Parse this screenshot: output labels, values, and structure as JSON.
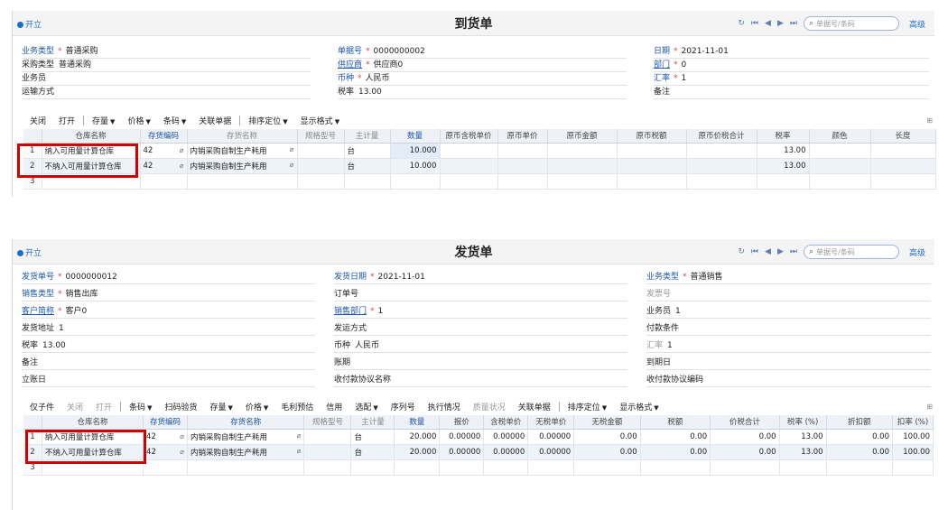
{
  "common": {
    "kaili": "开立",
    "search_placeholder": "单据号/条码",
    "advanced": "高级",
    "nav_icons": [
      "refresh-icon",
      "first-icon",
      "prev-icon",
      "next-icon",
      "last-icon"
    ]
  },
  "arrival": {
    "title": "到货单",
    "fields": {
      "biz_type": {
        "label": "业务类型",
        "value": "普通采购"
      },
      "doc_no": {
        "label": "单据号",
        "value": "0000000002"
      },
      "date": {
        "label": "日期",
        "value": "2021-11-01"
      },
      "purchase_type": {
        "label": "采购类型",
        "value": "普通采购"
      },
      "supplier": {
        "label": "供应商",
        "value": "供应商0"
      },
      "dept": {
        "label": "部门",
        "value": "0"
      },
      "salesman": {
        "label": "业务员",
        "value": ""
      },
      "currency": {
        "label": "币种",
        "value": "人民币"
      },
      "rate": {
        "label": "汇率",
        "value": "1"
      },
      "transport": {
        "label": "运输方式",
        "value": ""
      },
      "tax_rate": {
        "label": "税率",
        "value": "13.00"
      },
      "remark": {
        "label": "备注",
        "value": ""
      }
    },
    "toolbar": [
      "关闭",
      "打开",
      "存量",
      "价格",
      "条码",
      "关联单据",
      "排序定位",
      "显示格式"
    ],
    "columns": [
      "仓库名称",
      "存货编码",
      "存货名称",
      "规格型号",
      "主计量",
      "数量",
      "原币含税单价",
      "原币单价",
      "原币金额",
      "原币税额",
      "原币价税合计",
      "税率",
      "颜色",
      "长度"
    ],
    "rows": [
      {
        "idx": "1",
        "wh": "纳入可用量计算仓库",
        "code": "42",
        "name": "内销采购自制生产耗用",
        "unit": "台",
        "qty": "10.000",
        "tax": "13.00"
      },
      {
        "idx": "2",
        "wh": "不纳入可用量计算仓库",
        "code": "42",
        "name": "内销采购自制生产耗用",
        "unit": "台",
        "qty": "10.000",
        "tax": "13.00"
      },
      {
        "idx": "3"
      }
    ]
  },
  "delivery": {
    "title": "发货单",
    "fields": {
      "doc_no": {
        "label": "发货单号",
        "value": "0000000012"
      },
      "ship_date": {
        "label": "发货日期",
        "value": "2021-11-01"
      },
      "biz_type": {
        "label": "业务类型",
        "value": "普通销售"
      },
      "sales_type": {
        "label": "销售类型",
        "value": "销售出库"
      },
      "order_no": {
        "label": "订单号",
        "value": ""
      },
      "invoice_no": {
        "label": "发票号",
        "value": ""
      },
      "customer": {
        "label": "客户简称",
        "value": "客户0"
      },
      "sales_dept": {
        "label": "销售部门",
        "value": "1"
      },
      "salesman": {
        "label": "业务员",
        "value": "1"
      },
      "ship_addr": {
        "label": "发货地址",
        "value": "1"
      },
      "ship_method": {
        "label": "发运方式",
        "value": ""
      },
      "pay_terms": {
        "label": "付款条件",
        "value": ""
      },
      "tax_rate": {
        "label": "税率",
        "value": "13.00"
      },
      "currency": {
        "label": "币种",
        "value": "人民币"
      },
      "rate": {
        "label": "汇率",
        "value": "1"
      },
      "remark": {
        "label": "备注",
        "value": ""
      },
      "period": {
        "label": "账期",
        "value": ""
      },
      "due_date": {
        "label": "到期日",
        "value": ""
      },
      "acct_date": {
        "label": "立账日",
        "value": ""
      },
      "agreement_name": {
        "label": "收付款协议名称",
        "value": ""
      },
      "agreement_code": {
        "label": "收付款协议编码",
        "value": ""
      }
    },
    "toolbar": [
      "仅子件",
      "关闭",
      "打开",
      "条码",
      "扫码验货",
      "存量",
      "价格",
      "毛利预估",
      "信用",
      "选配",
      "序列号",
      "执行情况",
      "质量状况",
      "关联单据",
      "排序定位",
      "显示格式"
    ],
    "columns": [
      "仓库名称",
      "存货编码",
      "存货名称",
      "规格型号",
      "主计量",
      "数量",
      "报价",
      "含税单价",
      "无税单价",
      "无税金额",
      "税额",
      "价税合计",
      "税率 (%)",
      "折扣额",
      "扣率 (%)"
    ],
    "rows": [
      {
        "idx": "1",
        "wh": "纳入可用量计算仓库",
        "code": "42",
        "name": "内销采购自制生产耗用",
        "unit": "台",
        "qty": "20.000",
        "quote": "0.00000",
        "tax_price": "0.00000",
        "notax_price": "0.00000",
        "notax_amt": "0.00",
        "tax_amt": "0.00",
        "total": "0.00",
        "tax_rate": "13.00",
        "discount": "0.00",
        "deduct": "100.00"
      },
      {
        "idx": "2",
        "wh": "不纳入可用量计算仓库",
        "code": "42",
        "name": "内销采购自制生产耗用",
        "unit": "台",
        "qty": "20.000",
        "quote": "0.00000",
        "tax_price": "0.00000",
        "notax_price": "0.00000",
        "notax_amt": "0.00",
        "tax_amt": "0.00",
        "total": "0.00",
        "tax_rate": "13.00",
        "discount": "0.00",
        "deduct": "100.00"
      },
      {
        "idx": "3"
      }
    ]
  },
  "colors": {
    "accent": "#1a6fc9",
    "highlight": "#d40000",
    "required": "#dd4444"
  }
}
